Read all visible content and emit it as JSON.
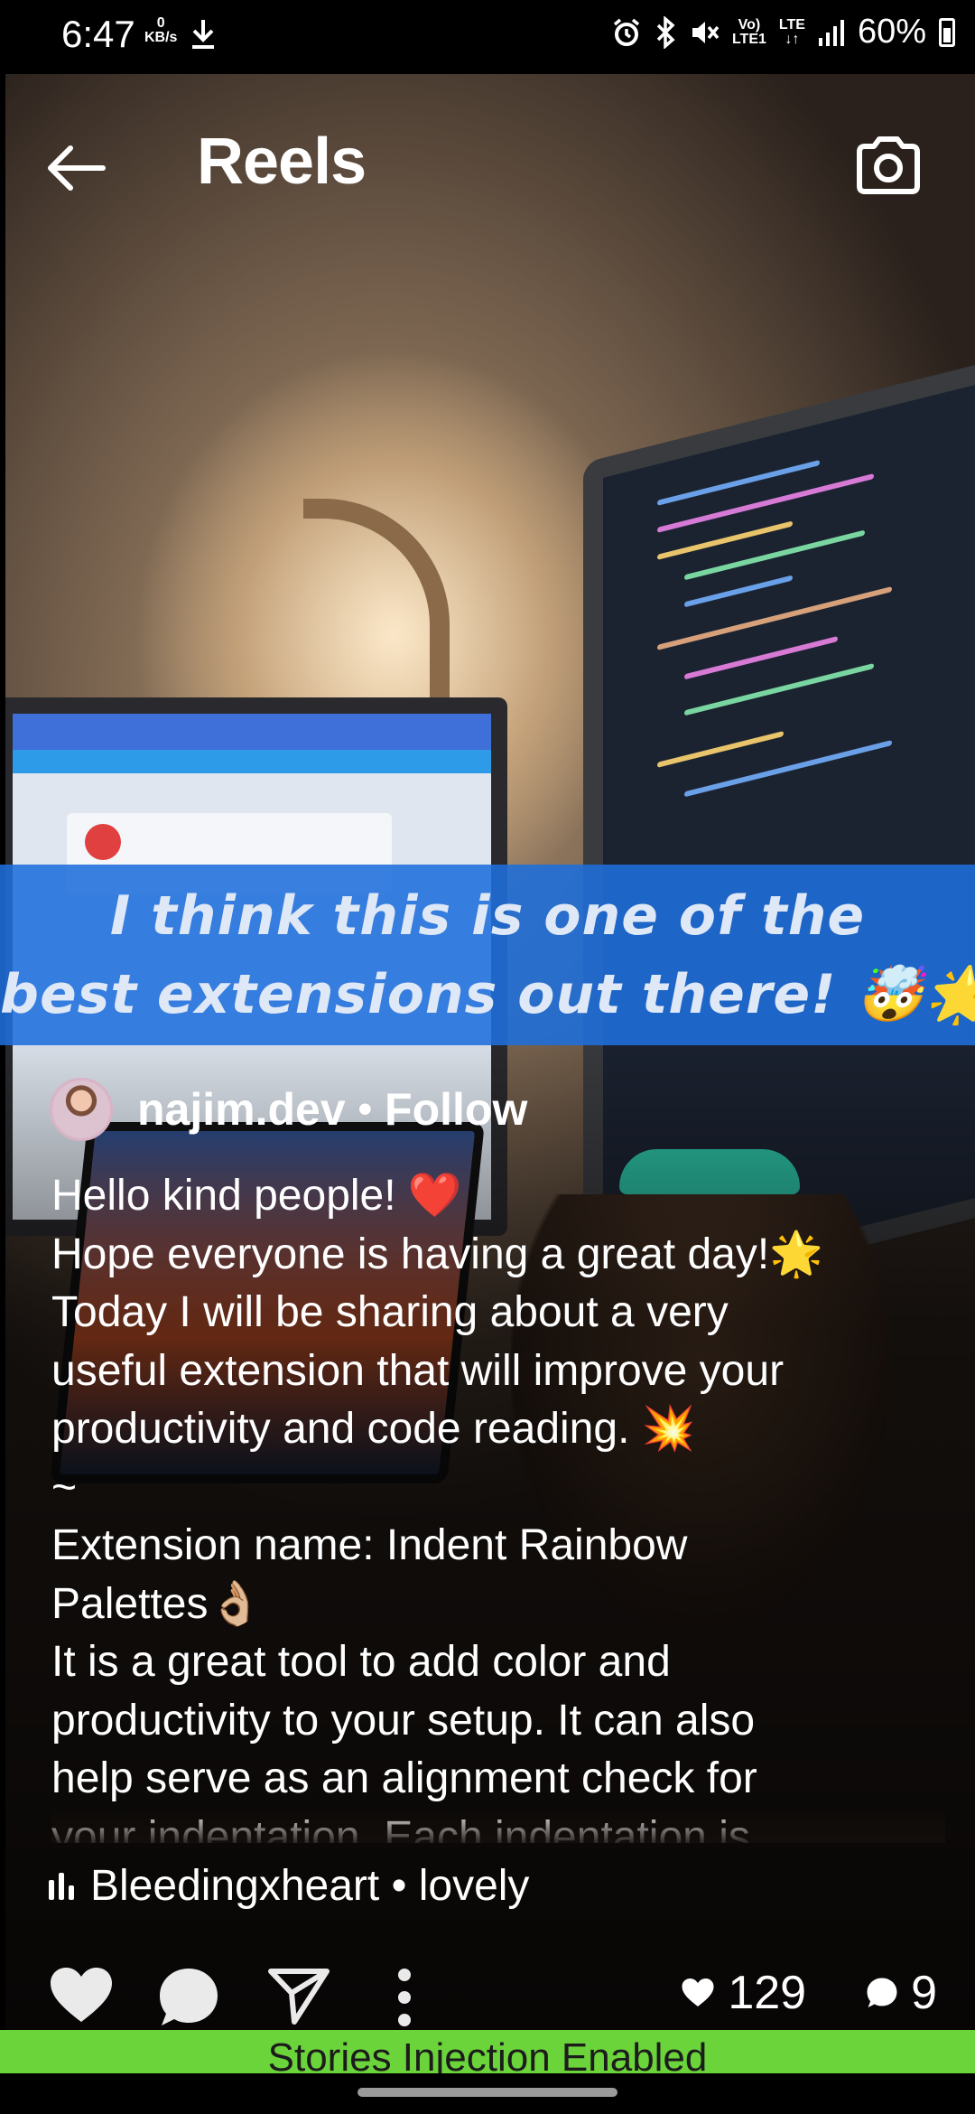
{
  "status_bar": {
    "time": "6:47",
    "net_speed_value": "0",
    "net_speed_unit": "KB/s",
    "volte_top": "Vo)",
    "volte_bottom": "LTE1",
    "lte_label": "LTE",
    "battery": "60%"
  },
  "header": {
    "title": "Reels"
  },
  "video": {
    "subtitle_line1": "I think this is one of the",
    "subtitle_line2": "best extensions out there! 🤯🌟"
  },
  "author": {
    "username": "najim.dev",
    "separator": "•",
    "follow_label": "Follow"
  },
  "caption": {
    "lines": [
      "Hello kind people! ❤️",
      "Hope everyone is having a great day!🌟",
      "Today I will be sharing about a very",
      "useful extension that will improve your",
      "productivity and code reading. 💥",
      "~",
      "Extension name: Indent Rainbow",
      "Palettes👌🏼",
      "It is a great tool to add color and",
      "productivity to your setup. It can also",
      "help serve as an alignment check for",
      "your indentation. Each indentation is"
    ]
  },
  "audio": {
    "label": "Bleedingxheart • lovely"
  },
  "actions": {
    "like_icon": "heart-icon",
    "comment_icon": "comment-icon",
    "share_icon": "send-icon",
    "more_icon": "more-vertical-icon",
    "likes_count": "129",
    "comments_count": "9"
  },
  "injection_bar": {
    "text": "Stories Injection Enabled",
    "color": "#6bd43a"
  }
}
